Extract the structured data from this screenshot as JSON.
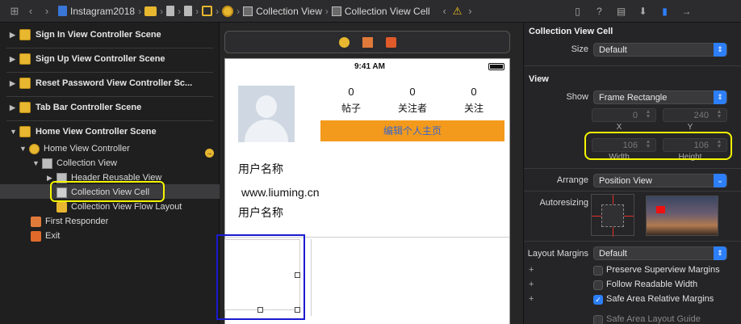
{
  "jumpbar": {
    "nav_grid_icon": "grid-icon",
    "back_icon": "chevron-left-icon",
    "forward_icon": "chevron-right-icon",
    "items": [
      {
        "label": "Instagram2018",
        "icon": "project-file-icon"
      },
      {
        "label": "",
        "icon": "folder-icon"
      },
      {
        "label": "",
        "icon": "document-icon"
      },
      {
        "label": "",
        "icon": "document-icon"
      },
      {
        "label": "",
        "icon": "scene-icon"
      },
      {
        "label": "",
        "icon": "view-controller-icon"
      },
      {
        "label": "Collection View",
        "icon": "collection-view-icon"
      },
      {
        "label": "Collection View Cell",
        "icon": "cell-icon"
      }
    ],
    "warning_icon": "warning-icon"
  },
  "inspector_tabs": [
    "file-icon",
    "help-icon",
    "identity-icon",
    "attributes-icon",
    "size-icon",
    "connections-icon"
  ],
  "outline": {
    "scenes": [
      {
        "label": "Sign In View Controller Scene",
        "expanded": false
      },
      {
        "label": "Sign Up View Controller Scene",
        "expanded": false
      },
      {
        "label": "Reset Password View Controller Sc...",
        "expanded": false
      },
      {
        "label": "Tab Bar Controller Scene",
        "expanded": false
      },
      {
        "label": "Home View Controller Scene",
        "expanded": true
      }
    ],
    "nodes": {
      "home_vc": "Home View Controller",
      "collection_view": "Collection View",
      "header_reusable": "Header Reusable View",
      "collection_cell": "Collection View Cell",
      "flow_layout": "Collection View Flow Layout",
      "first_responder": "First Responder",
      "exit": "Exit"
    }
  },
  "phone": {
    "status_time": "9:41 AM",
    "stats": [
      {
        "num": "0",
        "label": "帖子"
      },
      {
        "num": "0",
        "label": "关注者"
      },
      {
        "num": "0",
        "label": "关注"
      }
    ],
    "edit_button": "编辑个人主页",
    "username_1": "用户名称",
    "website": "www.liuming.cn",
    "username_2": "用户名称"
  },
  "inspector": {
    "cell_title": "Collection View Cell",
    "size_label": "Size",
    "size_value": "Default",
    "view_title": "View",
    "show_label": "Show",
    "show_value": "Frame Rectangle",
    "x_value": "0",
    "y_value": "240",
    "x_caption": "X",
    "y_caption": "Y",
    "width_value": "106",
    "height_value": "106",
    "width_caption": "Width",
    "height_caption": "Height",
    "arrange_label": "Arrange",
    "arrange_value": "Position View",
    "autoresizing_label": "Autoresizing",
    "layout_margins_label": "Layout Margins",
    "layout_margins_value": "Default",
    "preserve_superview": "Preserve Superview Margins",
    "follow_readable": "Follow Readable Width",
    "safe_area_relative": "Safe Area Relative Margins",
    "safe_area_layout": "Safe Area Layout Guide",
    "accent_color": "#2d7ff9",
    "highlight_color": "#f4f400"
  }
}
